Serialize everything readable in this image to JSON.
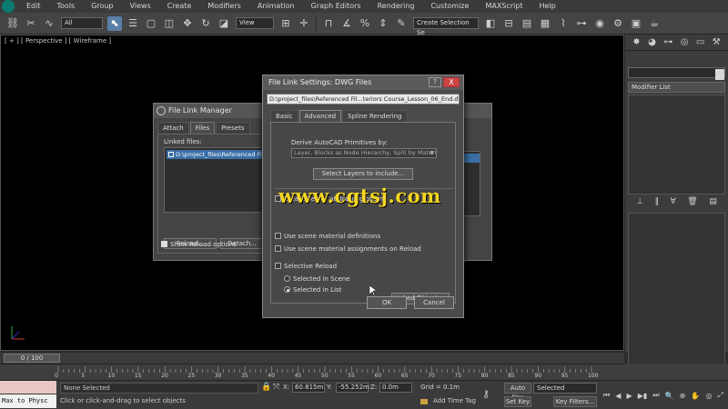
{
  "menu": [
    "Edit",
    "Tools",
    "Group",
    "Views",
    "Create",
    "Modifiers",
    "Animation",
    "Graph Editors",
    "Rendering",
    "Customize",
    "MAXScript",
    "Help"
  ],
  "toolbar": {
    "filter_select": "All",
    "ref_coord_select": "View",
    "named_selection": "Create Selection Se",
    "icons": [
      "link-icon",
      "unlink-icon",
      "bind-icon",
      "select-icon",
      "select-by-name-icon",
      "rect-region-icon",
      "window-crossing-icon",
      "move-icon",
      "rotate-icon",
      "scale-icon",
      "pivot-icon",
      "snap-icon",
      "angle-snap-icon",
      "percent-snap-icon",
      "spinner-snap-icon",
      "edit-named-icon",
      "mirror-icon",
      "align-icon",
      "layer-icon",
      "curve-editor-icon",
      "schematic-icon",
      "material-editor-icon",
      "render-setup-icon",
      "render-frame-icon",
      "render-icon"
    ]
  },
  "viewport": {
    "label": "[ + ] [ Perspective ] [ Wireframe ]"
  },
  "command_panel": {
    "tab_icons": [
      "create-icon",
      "modify-icon",
      "hierarchy-icon",
      "motion-icon",
      "display-icon",
      "utilities-icon"
    ],
    "modifier_list": "Modifier List",
    "stack_icons": [
      "pin-stack-icon",
      "show-end-icon",
      "make-unique-icon",
      "remove-modifier-icon",
      "configure-icon"
    ]
  },
  "timeline": {
    "slider": "0 / 100",
    "ticks": [
      "0",
      "5",
      "10",
      "15",
      "20",
      "25",
      "30",
      "35",
      "40",
      "45",
      "50",
      "55",
      "60",
      "65",
      "70",
      "75",
      "80",
      "85",
      "90",
      "95",
      "100"
    ]
  },
  "status": {
    "maxscript": "Max to Physc",
    "selection": "None Selected",
    "prompt": "Click or click-and-drag to select objects",
    "x_label": "X:",
    "x": "60.815m",
    "y_label": "Y:",
    "y": "-55.252m",
    "z_label": "Z:",
    "z": "0.0m",
    "grid": "Grid = 0.1m",
    "add_time_tag": "Add Time Tag",
    "auto_key": "Auto Key",
    "set_key": "Set Key",
    "selected": "Selected",
    "key_filters": "Key Filters..."
  },
  "flm": {
    "title": "File Link Manager",
    "tabs": [
      "Attach",
      "Files",
      "Presets"
    ],
    "linked_label": "Linked files:",
    "list_item": "D:\\project_files\\Referenced File",
    "reload": "Reload...",
    "detach": "Detach...",
    "show_reload": "Show Reload options"
  },
  "fls": {
    "title": "File Link Settings: DWG Files",
    "help": "?",
    "close": "X",
    "path": "D:\\project_files\\Referenced Fil...teriors Course_Lesson_06_End.dwg",
    "tabs": [
      "Basic",
      "Advanced",
      "Spline Rendering"
    ],
    "derive_label": "Derive AutoCAD Primitives by:",
    "derive_value": "Layer, Blocks as Node Hierarchy, Split by Materia",
    "select_layers": "Select Layers to include...",
    "create_helper": "Create helper at drawing origin",
    "use_scene_material": "Use scene material definitions",
    "use_scene_material_assign": "Use scene material assignments on Reload",
    "selective_reload": "Selective Reload",
    "selected_in_scene": "Selected in Scene",
    "selected_in_list": "Selected in List",
    "linked_objects": "Linked Objects...",
    "ok": "OK",
    "cancel": "Cancel"
  },
  "watermark": "www.cgtsj.com",
  "colors": {
    "selection_blue": "#3a6ea5",
    "watermark": "#f5d620",
    "active_tool": "#5a7fa8"
  }
}
